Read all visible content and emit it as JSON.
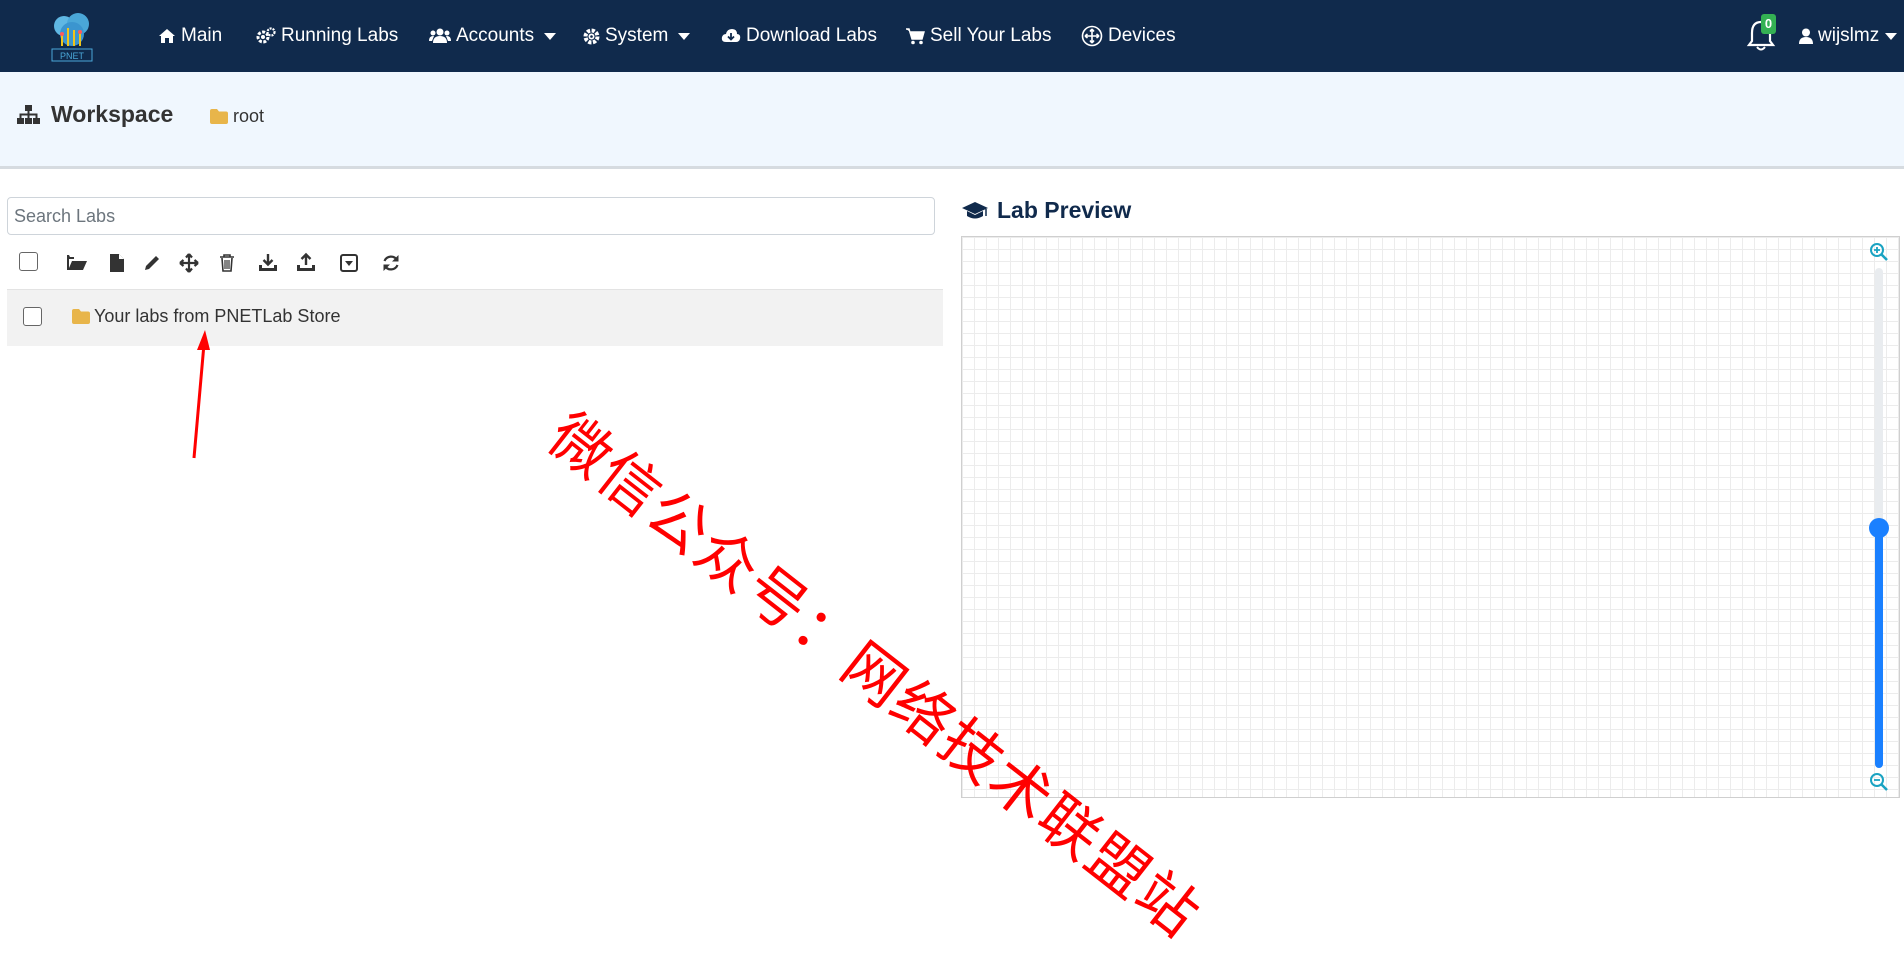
{
  "navbar": {
    "logo_text": "PNET",
    "items": [
      {
        "label": "Main",
        "icon": "home-icon"
      },
      {
        "label": "Running Labs",
        "icon": "cogs-icon"
      },
      {
        "label": "Accounts",
        "icon": "users-icon",
        "dropdown": true
      },
      {
        "label": "System",
        "icon": "gear-icon",
        "dropdown": true
      },
      {
        "label": "Download Labs",
        "icon": "cloud-download-icon"
      },
      {
        "label": "Sell Your Labs",
        "icon": "cart-icon"
      },
      {
        "label": "Devices",
        "icon": "move-circle-icon"
      }
    ],
    "notifications_count": "0",
    "user": "wijslmz"
  },
  "workspace": {
    "title": "Workspace",
    "breadcrumb_root": "root"
  },
  "left_panel": {
    "search_placeholder": "Search Labs",
    "toolbar_icons": [
      "select-all-checkbox",
      "open-folder-icon",
      "new-file-icon",
      "edit-pencil-icon",
      "move-icon",
      "trash-icon",
      "import-icon",
      "export-icon",
      "collapse-icon",
      "refresh-icon"
    ],
    "folders": [
      {
        "label": "Your labs from PNETLab Store"
      }
    ]
  },
  "right_panel": {
    "title": "Lab Preview",
    "zoom_level_fraction": 0.52
  },
  "overlay": {
    "watermark": "微信公众号：网络技术联盟站"
  },
  "colors": {
    "navbar": "#102a4c",
    "header_bg": "#f0f7fe",
    "folder": "#e8b54a",
    "accent": "#1a80ff",
    "annotation": "#ff0000"
  }
}
